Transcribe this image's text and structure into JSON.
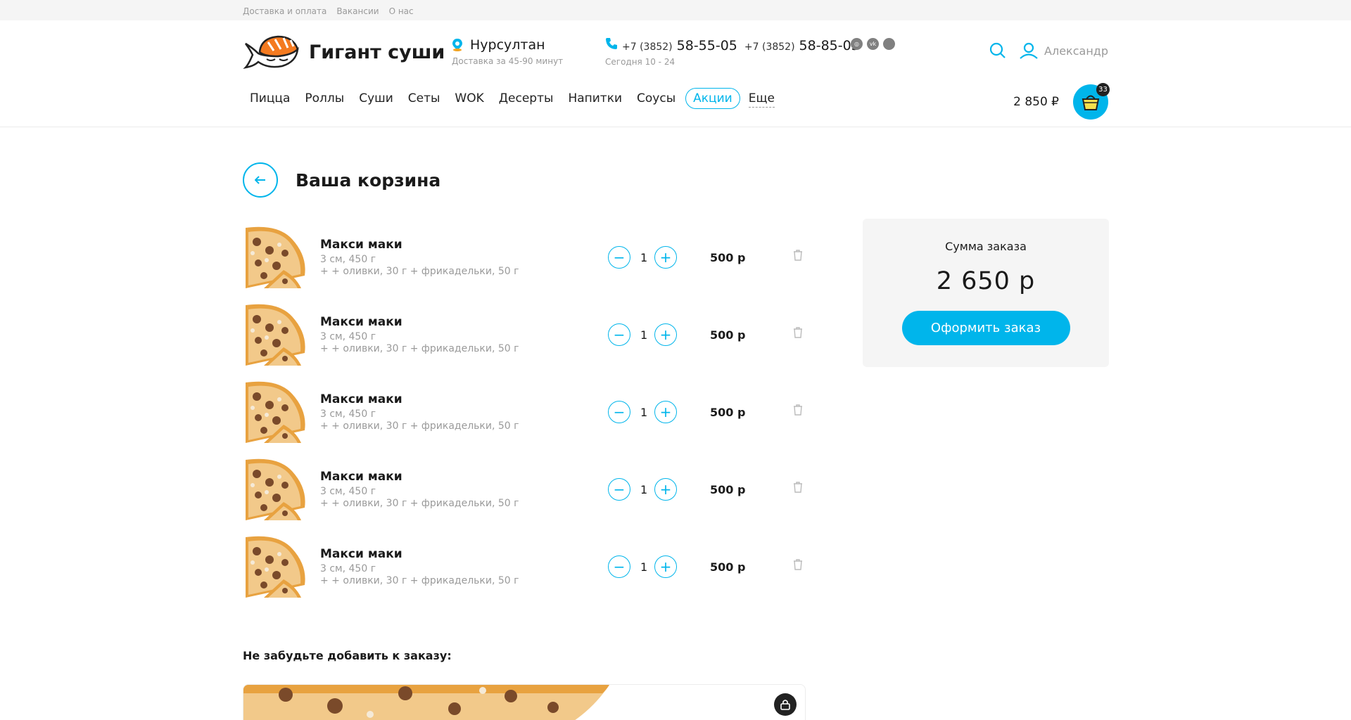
{
  "topbar": {
    "links": [
      "Доставка и оплата",
      "Вакансии",
      "О нас"
    ]
  },
  "brand": {
    "name": "Гигант суши",
    "accent": "#00b5eb"
  },
  "location": {
    "city": "Нурсултан",
    "delivery_time": "Доставка за 45-90 минут"
  },
  "phones": {
    "prefix1": "+7 (3852)",
    "number1": "58-55-05",
    "prefix2": "+7 (3852)",
    "number2": "58-85-05",
    "hours": "Сегодня 10 - 24"
  },
  "socials": [
    "instagram-icon",
    "vk-icon",
    "other-social-icon"
  ],
  "user": {
    "name": "Александр"
  },
  "nav": {
    "items": [
      "Пицца",
      "Роллы",
      "Суши",
      "Сеты",
      "WOK",
      "Десерты",
      "Напитки",
      "Соусы"
    ],
    "active": "Акции",
    "more": "Еще"
  },
  "cart": {
    "total": "2 850 ₽",
    "count": "33"
  },
  "page": {
    "title": "Ваша корзина"
  },
  "items": [
    {
      "name": "Макси маки",
      "weight": "3 см, 450 г",
      "adds": "+ + оливки, 30 г + фрикадельки, 50 г",
      "qty": "1",
      "price": "500 р"
    },
    {
      "name": "Макси маки",
      "weight": "3 см, 450 г",
      "adds": "+ + оливки, 30 г + фрикадельки, 50 г",
      "qty": "1",
      "price": "500 р"
    },
    {
      "name": "Макси маки",
      "weight": "3 см, 450 г",
      "adds": "+ + оливки, 30 г + фрикадельки, 50 г",
      "qty": "1",
      "price": "500 р"
    },
    {
      "name": "Макси маки",
      "weight": "3 см, 450 г",
      "adds": "+ + оливки, 30 г + фрикадельки, 50 г",
      "qty": "1",
      "price": "500 р"
    },
    {
      "name": "Макси маки",
      "weight": "3 см, 450 г",
      "adds": "+ + оливки, 30 г + фрикадельки, 50 г",
      "qty": "1",
      "price": "500 р"
    }
  ],
  "summary": {
    "label": "Сумма заказа",
    "value": "2 650 р",
    "checkout": "Оформить заказ"
  },
  "reminder": {
    "title": "Не забудьте добавить к заказу:"
  }
}
